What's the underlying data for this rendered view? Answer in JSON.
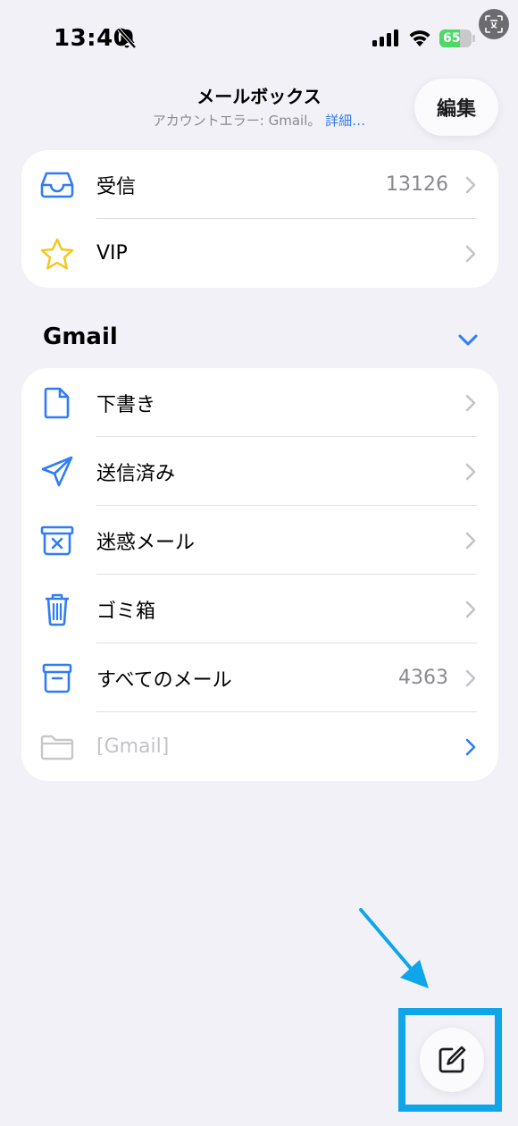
{
  "status_bar": {
    "time": "13:40",
    "battery_level": "65",
    "battery_fraction": 0.65
  },
  "header": {
    "title": "メールボックス",
    "subtitle": "アカウントエラー: Gmail。",
    "subtitle_link": "詳細…",
    "edit_label": "編集"
  },
  "mailboxes": [
    {
      "label": "受信",
      "count": "13126",
      "icon": "inbox-icon"
    },
    {
      "label": "VIP",
      "count": "",
      "icon": "star-icon"
    }
  ],
  "gmail_section": {
    "title": "Gmail",
    "items": [
      {
        "label": "下書き",
        "count": "",
        "icon": "document-icon"
      },
      {
        "label": "送信済み",
        "count": "",
        "icon": "paper-plane-icon"
      },
      {
        "label": "迷惑メール",
        "count": "",
        "icon": "junk-icon"
      },
      {
        "label": "ゴミ箱",
        "count": "",
        "icon": "trash-icon"
      },
      {
        "label": "すべてのメール",
        "count": "4363",
        "icon": "archive-icon"
      },
      {
        "label": "[Gmail]",
        "count": "",
        "icon": "folder-icon"
      }
    ]
  },
  "colors": {
    "accent": "#2f7cf6",
    "background": "#f2f1f7",
    "star": "#f5c518",
    "annotation": "#0ea5e9"
  }
}
